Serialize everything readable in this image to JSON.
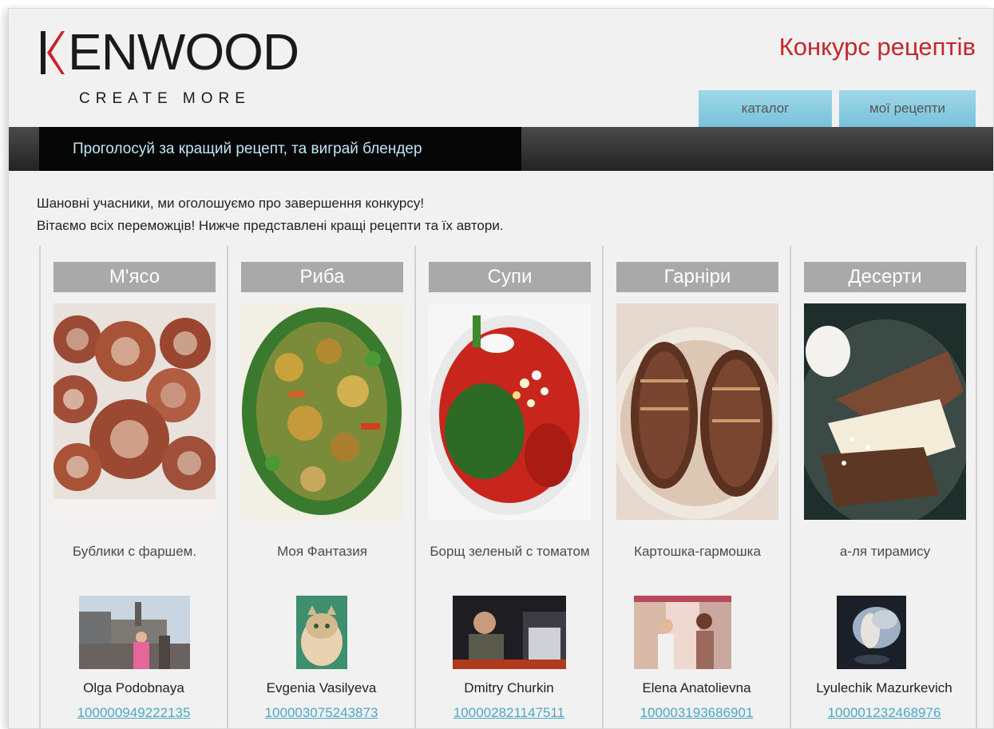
{
  "header": {
    "logo_text": "ENWOOD",
    "logo_tagline": "CREATE MORE",
    "contest_title": "Конкурс рецептів"
  },
  "nav": {
    "tabs": [
      {
        "label": "каталог"
      },
      {
        "label": "мої рецепти"
      }
    ]
  },
  "banner": {
    "text": "Проголосуй за кращий рецепт, та виграй блендер"
  },
  "intro": {
    "line1": "Шановні учасники, ми оголошуємо про завершення конкурсу!",
    "line2": "Вітаємо всіх переможців! Нижче представлені кращі рецепти та їх автори."
  },
  "colors": {
    "brand_red": "#d0202a",
    "title_red": "#c4272d",
    "tab_blue": "#8ccfe3",
    "banner_text": "#bfe6f5",
    "link_blue": "#4ea7c6",
    "category_gray": "#a9a9a9"
  },
  "categories": [
    {
      "name": "М'ясо",
      "recipe": "Бублики с фаршем.",
      "author": "Olga Podobnaya",
      "user_id": "100000949222135"
    },
    {
      "name": "Риба",
      "recipe": "Моя Фантазия",
      "author": "Evgenia Vasilyeva",
      "user_id": "100003075243873"
    },
    {
      "name": "Супи",
      "recipe": "Борщ зеленый с томатом",
      "author": "Dmitry Churkin",
      "user_id": "100002821147511"
    },
    {
      "name": "Гарніри",
      "recipe": "Картошка-гармошка",
      "author": "Elena Anatolievna",
      "user_id": "100003193686901"
    },
    {
      "name": "Десерти",
      "recipe": "а-ля тирамису",
      "author": "Lyulechik Mazurkevich",
      "user_id": "100001232468976"
    }
  ]
}
